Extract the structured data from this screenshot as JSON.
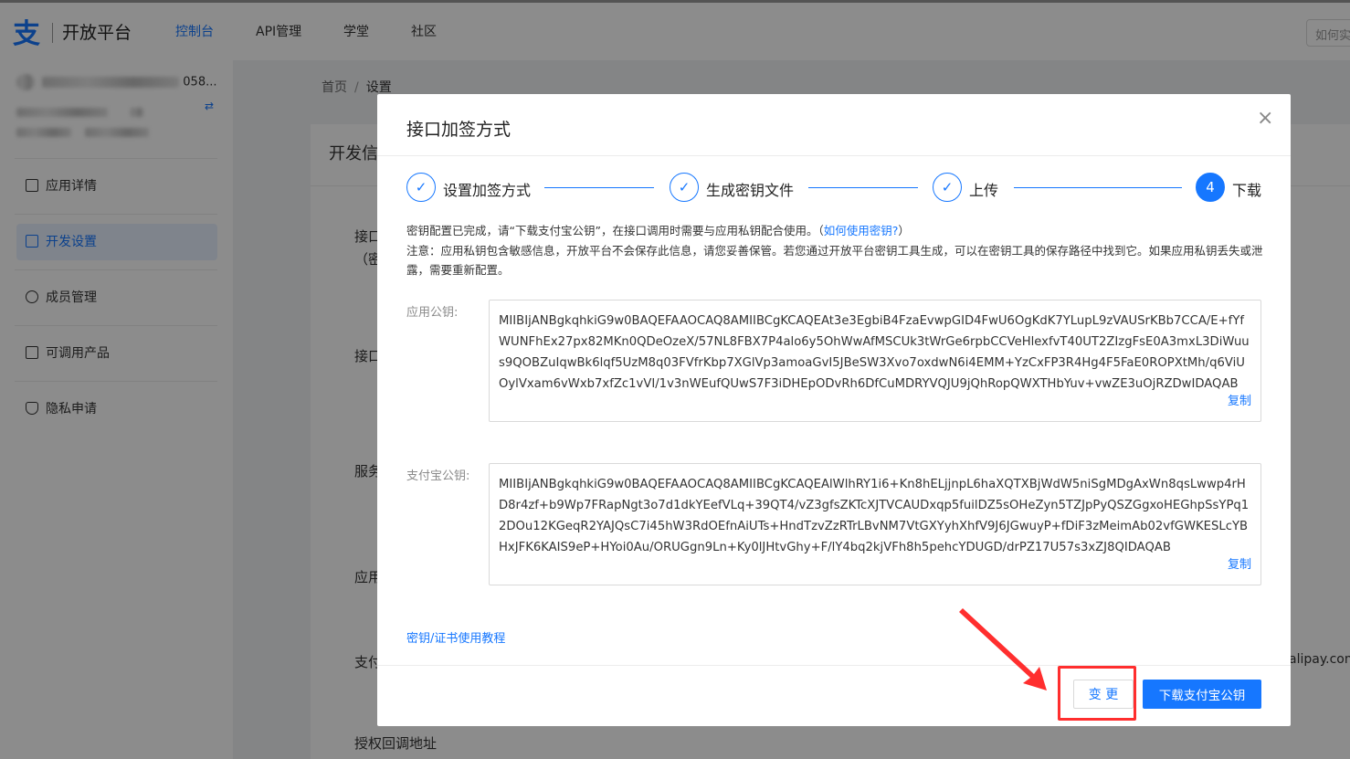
{
  "topnav": {
    "logo_mark": "支",
    "logo_text": "开放平台",
    "items": [
      {
        "label": "控制台",
        "active": true
      },
      {
        "label": "API管理",
        "active": false
      },
      {
        "label": "学堂",
        "active": false
      },
      {
        "label": "社区",
        "active": false
      }
    ],
    "search_placeholder": "如何实"
  },
  "sidebar": {
    "account_suffix": "058...",
    "items": [
      {
        "label": "应用详情",
        "active": false
      },
      {
        "label": "开发设置",
        "active": true
      },
      {
        "label": "成员管理",
        "active": false
      },
      {
        "label": "可调用产品",
        "active": false
      },
      {
        "label": "隐私申请",
        "active": false
      }
    ]
  },
  "breadcrumb": {
    "home": "首页",
    "separator": "/",
    "current": "设置"
  },
  "background_card": {
    "title": "开发信",
    "labels": [
      "接口",
      "（密",
      "接口",
      "服务",
      "应用",
      "支付",
      "授权回调地址"
    ],
    "right_text": "alipay.com"
  },
  "modal": {
    "title": "接口加签方式",
    "close": "×",
    "steps": [
      {
        "label": "设置加签方式",
        "status": "done",
        "mark": "✓"
      },
      {
        "label": "生成密钥文件",
        "status": "done",
        "mark": "✓"
      },
      {
        "label": "上传",
        "status": "done",
        "mark": "✓"
      },
      {
        "label": "下载",
        "status": "current",
        "mark": "4"
      }
    ],
    "notice_line1_pre": "密钥配置已完成，请“下载支付宝公钥”，在接口调用时需要与应用私钥配合使用。（",
    "notice_line1_link": "如何使用密钥?",
    "notice_line1_post": "）",
    "notice_line2": "注意：应用私钥包含敏感信息，开放平台不会保存此信息，请您妥善保管。若您通过开放平台密钥工具生成，可以在密钥工具的保存路径中找到它。如果应用私钥丢失或泄露，需要重新配置。",
    "app_public_key_label": "应用公钥:",
    "app_public_key": "MIIBIjANBgkqhkiG9w0BAQEFAAOCAQ8AMIIBCgKCAQEAt3e3EgbiB4FzaEvwpGID4FwU6OgKdK7YLupL9zVAUSrKBb7CCA/E+fYfWUNFhEx27px82MKn0QDeOzeX/57NL8FBX7P4alo6y5OhWwAfMSCUk3tWrGe6rpbCCVeHlexfvT40UT2ZIzgFsE0A3mxL3DiWuus9QOBZuIqwBk6lqf5UzM8q03FVfrKbp7XGlVp3amoaGvI5JBeSW3Xvo7oxdwN6i4EMM+YzCxFP3R4Hg4F5FaE0ROPXtMh/q6ViUOylVxam6vWxb7xfZc1vVI/1v3nWEufQUwS7F3iDHEpODvRh6DfCuMDRYVQJU9jQhRopQWXTHbYuv+vwZE3uOjRZDwIDAQAB",
    "alipay_public_key_label": "支付宝公钥:",
    "alipay_public_key": "MIIBIjANBgkqhkiG9w0BAQEFAAOCAQ8AMIIBCgKCAQEAlWlhRY1i6+Kn8hELjjnpL6haXQTXBjWdW5niSgMDgAxWn8qsLwwp4rHD8r4zf+b9Wp7FRapNgt3o7d1dkYEefVLq+39QT4/vZ3gfsZKTcXJTVCAUDxqp5fuilDZ5sOHeZyn5TZJpPyQSZGgxoHEGhpSsYPq12DOu12KGeqR2YAJQsC7i45hW3RdOEfnAiUTs+HndTzvZzRTrLBvNM7VtGXYyhXhfV9J6JGwuyP+fDiF3zMeimAb02vfGWKESLcYBHxJFK6KAIS9eP+HYoi0Au/ORUGgn9Ln+Ky0lJHtvGhy+F/lY4bq2kjVFh8h5pehcYDUGD/drPZ17U57s3xZJ8QIDAQAB",
    "copy_label": "复制",
    "tutorial_link": "密钥/证书使用教程",
    "btn_change": "变 更",
    "btn_download": "下载支付宝公钥"
  },
  "annotation": {
    "color": "#ff2e2e"
  }
}
